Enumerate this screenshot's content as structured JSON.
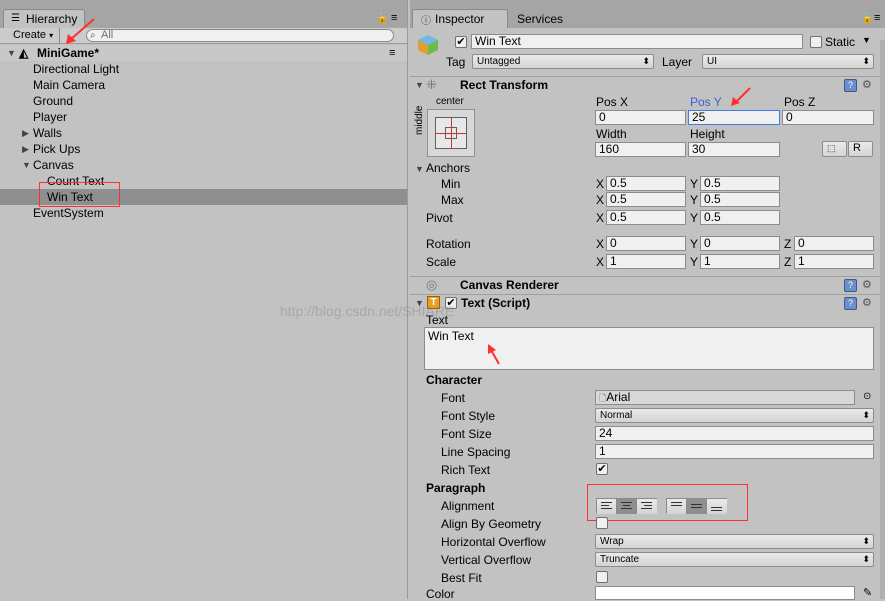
{
  "hierarchy": {
    "tab_label": "Hierarchy",
    "create_label": "Create",
    "search_placeholder": "All",
    "scene_name": "MiniGame*",
    "items": [
      {
        "label": "Directional Light"
      },
      {
        "label": "Main Camera"
      },
      {
        "label": "Ground"
      },
      {
        "label": "Player"
      },
      {
        "label": "Walls"
      },
      {
        "label": "Pick Ups"
      },
      {
        "label": "Canvas"
      },
      {
        "label": "Count Text"
      },
      {
        "label": "Win Text"
      },
      {
        "label": "EventSystem"
      }
    ]
  },
  "inspector": {
    "tabs": [
      {
        "label": "Inspector"
      },
      {
        "label": "Services"
      }
    ],
    "object_name": "Win Text",
    "static_label": "Static",
    "tag_label": "Tag",
    "tag_value": "Untagged",
    "layer_label": "Layer",
    "layer_value": "UI",
    "rect_transform": {
      "title": "Rect Transform",
      "anchor_h": "center",
      "anchor_v": "middle",
      "pos_x_label": "Pos X",
      "pos_x": "0",
      "pos_y_label": "Pos Y",
      "pos_y": "25",
      "pos_z_label": "Pos Z",
      "pos_z": "0",
      "width_label": "Width",
      "width": "160",
      "height_label": "Height",
      "height": "30",
      "r_button": "R",
      "anchors_label": "Anchors",
      "min_label": "Min",
      "min_x": "0.5",
      "min_y": "0.5",
      "max_label": "Max",
      "max_x": "0.5",
      "max_y": "0.5",
      "pivot_label": "Pivot",
      "pivot_x": "0.5",
      "pivot_y": "0.5",
      "rotation_label": "Rotation",
      "rot_x": "0",
      "rot_y": "0",
      "rot_z": "0",
      "scale_label": "Scale",
      "scale_x": "1",
      "scale_y": "1",
      "scale_z": "1",
      "x": "X",
      "y": "Y",
      "z": "Z"
    },
    "canvas_renderer": {
      "title": "Canvas Renderer"
    },
    "text_script": {
      "title": "Text (Script)",
      "text_label": "Text",
      "text_value": "Win Text",
      "character_label": "Character",
      "font_label": "Font",
      "font_value": "Arial",
      "font_style_label": "Font Style",
      "font_style_value": "Normal",
      "font_size_label": "Font Size",
      "font_size_value": "24",
      "line_spacing_label": "Line Spacing",
      "line_spacing_value": "1",
      "rich_text_label": "Rich Text",
      "paragraph_label": "Paragraph",
      "alignment_label": "Alignment",
      "align_by_geometry_label": "Align By Geometry",
      "h_overflow_label": "Horizontal Overflow",
      "h_overflow_value": "Wrap",
      "v_overflow_label": "Vertical Overflow",
      "v_overflow_value": "Truncate",
      "best_fit_label": "Best Fit",
      "color_label": "Color"
    }
  },
  "watermark": "http://blog.csdn.net/SHIARE",
  "colors": {
    "selection": "#8f8f8f",
    "annotation": "#ff3030",
    "field_focus": "#3f7ce6"
  }
}
